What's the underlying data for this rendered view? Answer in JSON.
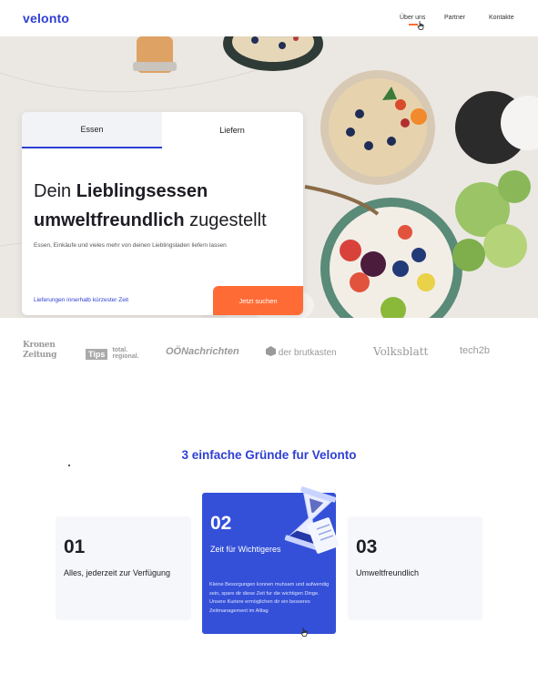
{
  "header": {
    "logo": "velonto",
    "nav": [
      {
        "label": "Über uns"
      },
      {
        "label": "Partner"
      },
      {
        "label": "Kontakte"
      }
    ]
  },
  "hero": {
    "tabs": [
      {
        "label": "Essen"
      },
      {
        "label": "Liefern"
      }
    ],
    "headline_part1": "Dein ",
    "headline_bold1": "Lieblingsessen",
    "headline_bold2": "umweltfreundlich",
    "headline_part2": " zugestellt",
    "subtext": "Essen,  Einkäufe und vieles mehr von deinen Lieblingsladen liefern lassen",
    "delivery_link": "Lieferungen innerhalb kürzester Zeit",
    "search_button": "Jetzt suchen"
  },
  "press": {
    "kronen_line1": "Kronen",
    "kronen_line2": "Zeitung",
    "tips": "Tips",
    "tips_line1": "total.",
    "tips_line2": "regional.",
    "oon": "OÖNachrichten",
    "brutkasten": "der brutkasten",
    "volksblatt": "Volksblatt",
    "tech": "tech2b"
  },
  "reasons": {
    "title": "3 einfache Gründe fur Velonto",
    "items": [
      {
        "number": "01",
        "label": "Alles, jederzeit zur Verfügung"
      },
      {
        "number": "02",
        "label": "Zeit für Wichtigeres",
        "description": "Kleine Besorgungen konnen muhsam und aufwendig sein, spare dir diese Zeit fur die wichtigen Dinge. Unsere Kuriere ermöglichen dir ein besseres Zeitmanagement im Alltag"
      },
      {
        "number": "03",
        "label": "Umweltfreundlich"
      }
    ]
  },
  "colors": {
    "brand_blue": "#2f3fd3",
    "accent_orange": "#ff6b35",
    "card_blue": "#3450d8"
  }
}
